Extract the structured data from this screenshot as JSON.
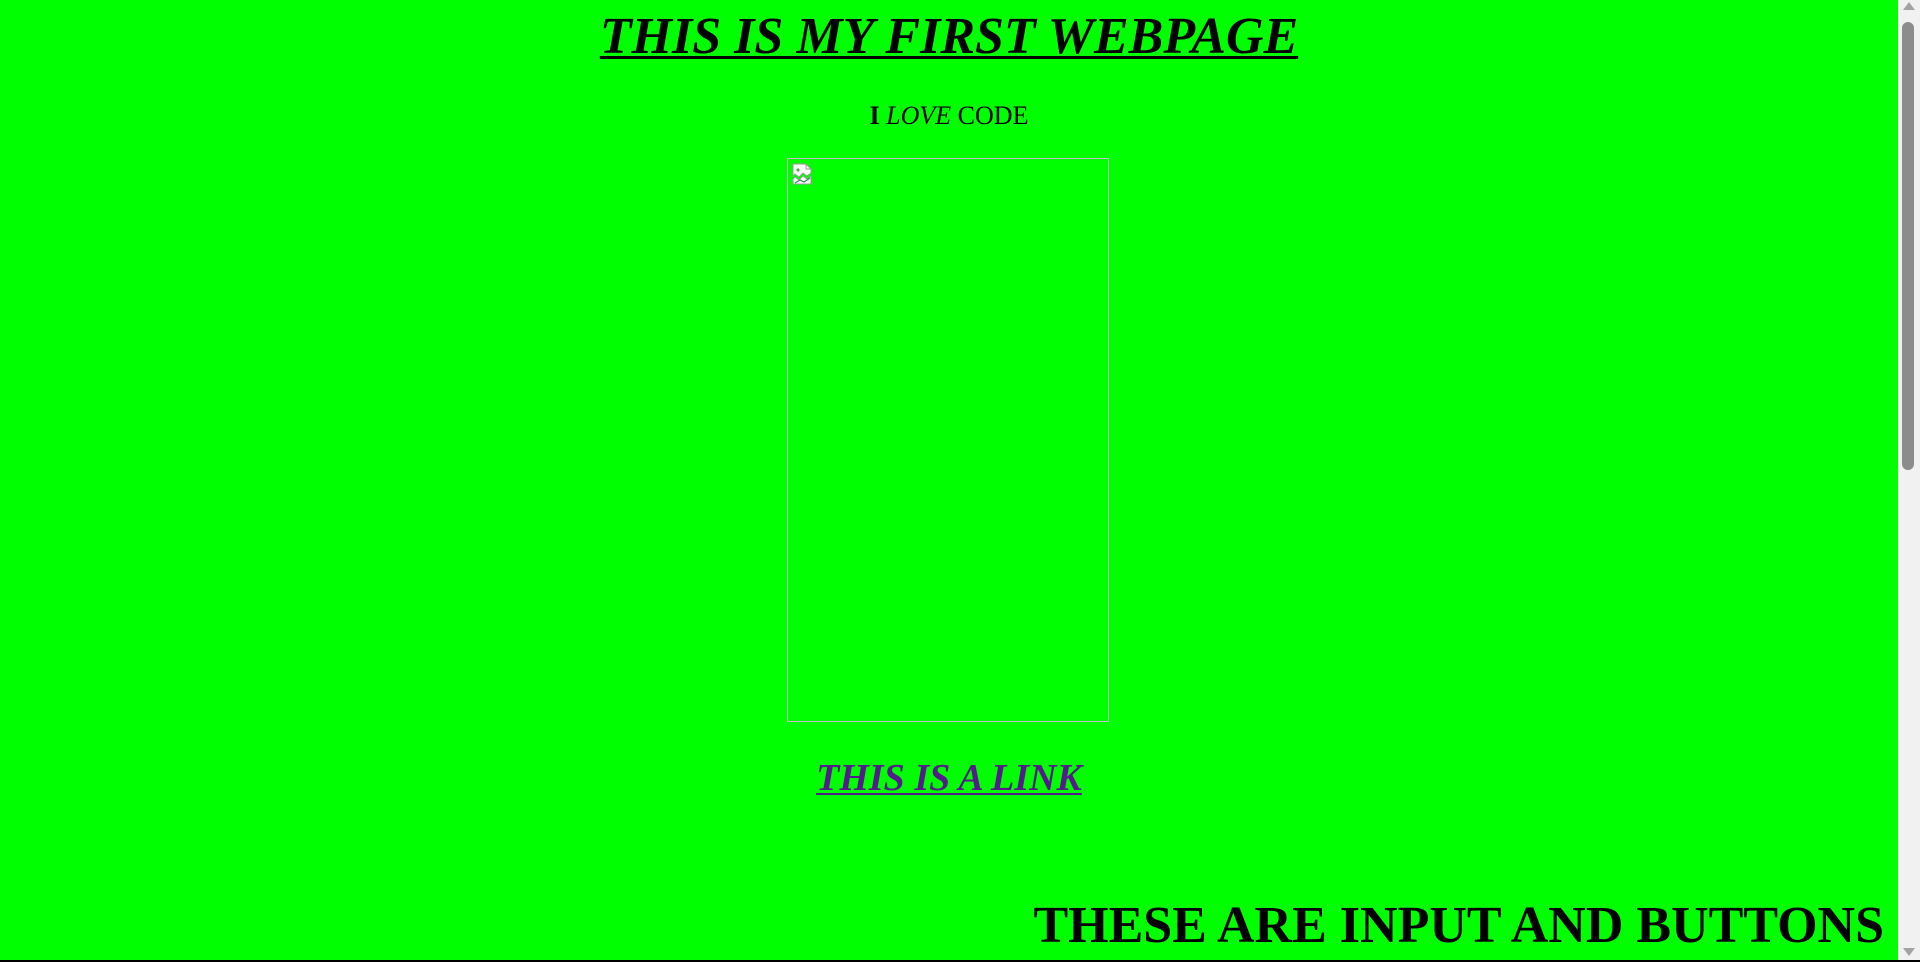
{
  "header": {
    "title": "THIS IS MY FIRST WEBPAGE"
  },
  "tagline": {
    "part1": "I",
    "part2": "LOVE",
    "part3": "CODE"
  },
  "image": {
    "icon": "broken-image-icon"
  },
  "link": {
    "label": "THIS IS A LINK"
  },
  "section": {
    "heading": "THESE ARE INPUT AND BUTTONS"
  },
  "colors": {
    "background": "#00ff00",
    "link": "#551a8b",
    "text": "#000000"
  },
  "scrollbar": {
    "icons": [
      "scroll-up-arrow-icon",
      "scroll-down-arrow-icon"
    ]
  }
}
